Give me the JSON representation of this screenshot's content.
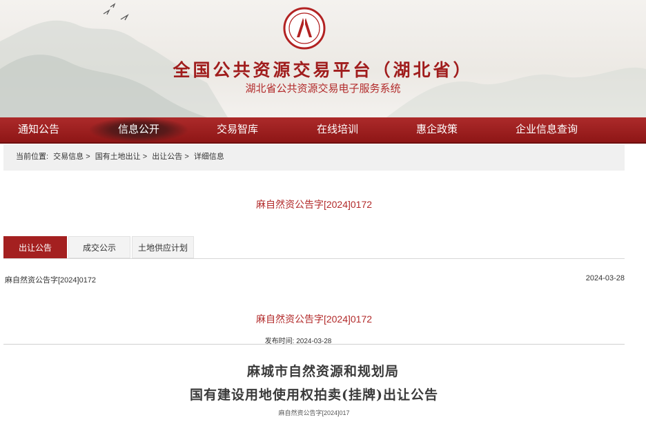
{
  "header": {
    "site_title": "全国公共资源交易平台（湖北省）",
    "site_subtitle": "湖北省公共资源交易电子服务系统",
    "brand_color": "#a01d1d"
  },
  "nav": {
    "items": [
      {
        "label": "通知公告",
        "active": false
      },
      {
        "label": "信息公开",
        "active": true
      },
      {
        "label": "交易智库",
        "active": false
      },
      {
        "label": "在线培训",
        "active": false
      },
      {
        "label": "惠企政策",
        "active": false
      },
      {
        "label": "企业信息查询",
        "active": false
      }
    ],
    "bg_color": "#9c1f1f"
  },
  "breadcrumb": {
    "label": "当前位置:",
    "items": [
      "交易信息",
      "国有土地出让",
      "出让公告",
      "详细信息"
    ],
    "separator": ">"
  },
  "document": {
    "heading": "麻自然资公告字[2024]0172",
    "tabs": [
      {
        "label": "出让公告",
        "active": true
      },
      {
        "label": "成交公示",
        "active": false
      },
      {
        "label": "土地供应计划",
        "active": false
      }
    ],
    "list_item": {
      "title": "麻自然资公告字[2024]0172",
      "date": "2024-03-28"
    },
    "detail_heading": "麻自然资公告字[2024]0172",
    "publish_label": "发布时间:",
    "publish_date": "2024-03-28",
    "body_title_1": "麻城市自然资源和规划局",
    "body_title_2": "国有建设用地使用权拍卖(挂牌)出让公告",
    "body_number": "麻自然资公告字[2024]017"
  }
}
